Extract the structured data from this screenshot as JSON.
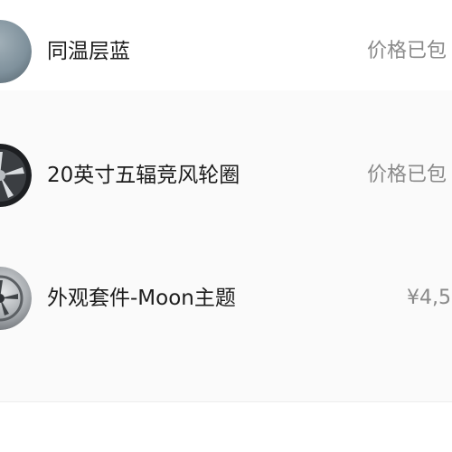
{
  "items": [
    {
      "name": "同温层蓝",
      "price": "价格已包",
      "icon": "paint-color-swatch-icon",
      "swatch_color": "#7f919c"
    },
    {
      "name": "20英寸五辐竞风轮圈",
      "price": "价格已包",
      "icon": "wheel-rim-icon"
    },
    {
      "name": "外观套件-Moon主题",
      "price": "¥4,5",
      "icon": "exterior-kit-icon"
    }
  ]
}
